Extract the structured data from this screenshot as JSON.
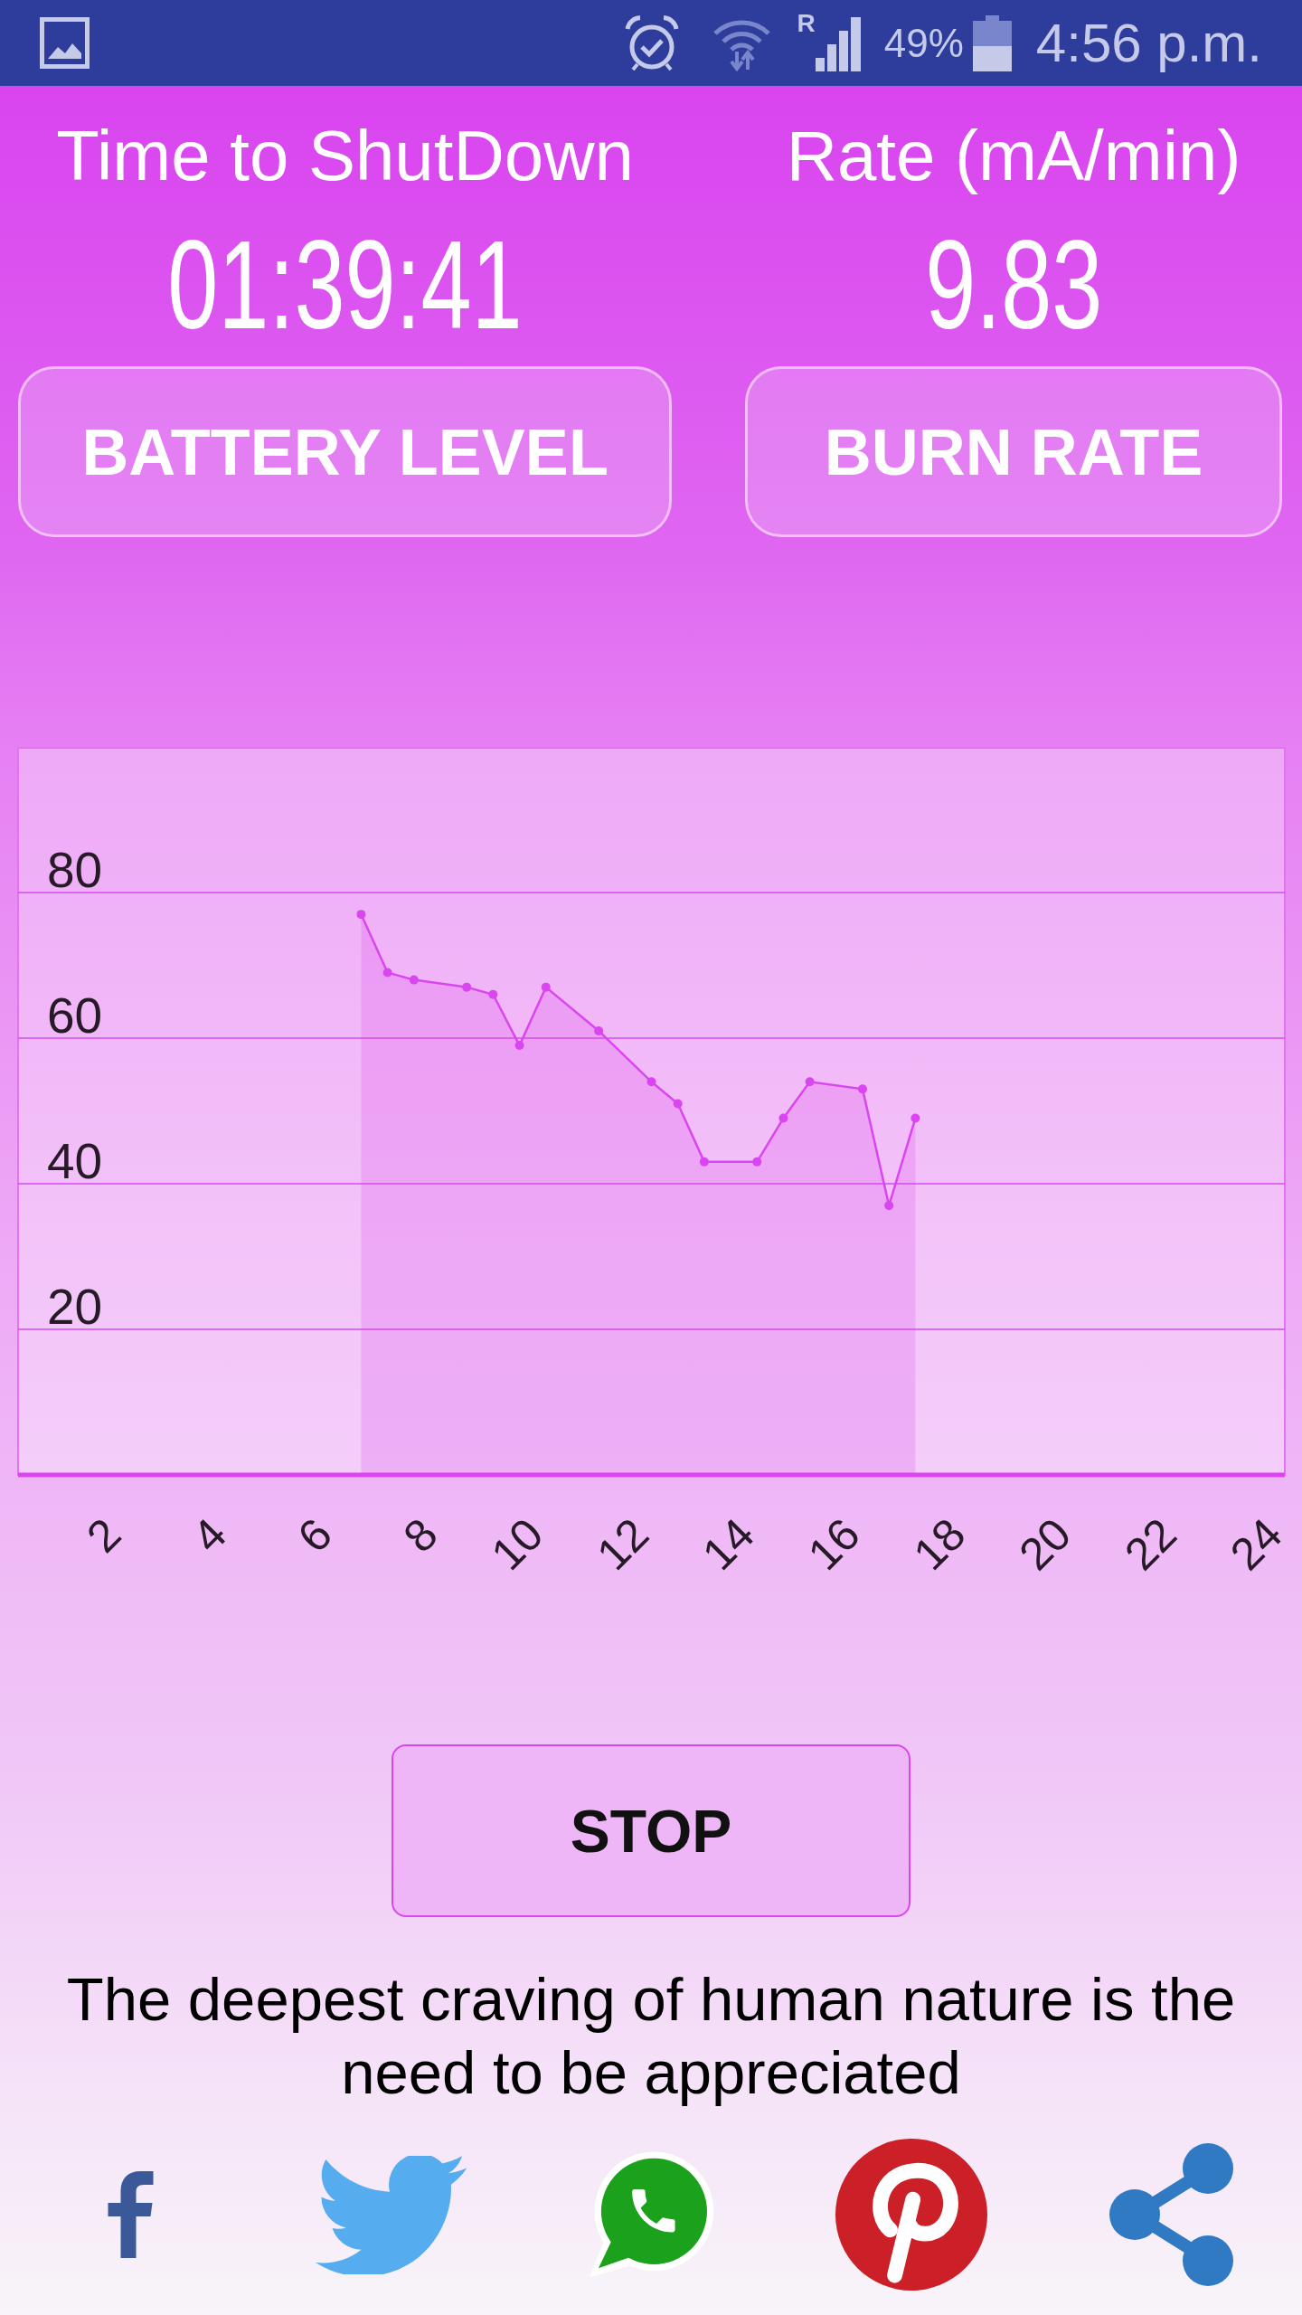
{
  "status_bar": {
    "roaming_mark": "R",
    "battery": "49%",
    "time": "4:56 p.m."
  },
  "readouts": [
    {
      "label": "Time to ShutDown",
      "value": "01:39:41"
    },
    {
      "label": "Rate (mA/min)",
      "value": "9.83"
    }
  ],
  "mode_buttons": [
    {
      "label": "BATTERY LEVEL"
    },
    {
      "label": "BURN RATE"
    }
  ],
  "chart": {
    "chart_data": {
      "type": "area",
      "grid": true,
      "x": [
        6.5,
        7,
        7.5,
        8.5,
        9,
        9.5,
        10,
        11,
        12,
        12.5,
        13,
        14,
        14.5,
        15,
        16,
        16.5,
        17
      ],
      "series": [
        {
          "color": "#d946ef",
          "values": [
            77,
            69,
            68,
            67,
            66,
            59,
            67,
            61,
            54,
            51,
            43,
            43,
            49,
            54,
            53,
            37,
            49
          ]
        }
      ],
      "xlim": [
        0,
        24
      ],
      "ylim": [
        0,
        100
      ],
      "xticks": [
        2,
        4,
        6,
        8,
        10,
        12,
        14,
        16,
        18,
        20,
        22,
        24
      ],
      "yticks": [
        20,
        40,
        60,
        80
      ]
    }
  },
  "stop_button": {
    "label": "STOP"
  },
  "quote": "The deepest craving of human nature is the need to be appreciated"
}
